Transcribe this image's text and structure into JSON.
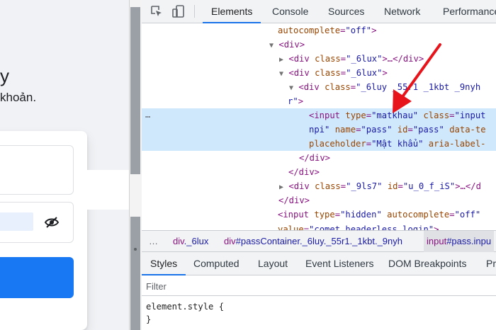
{
  "page": {
    "heading_fragment": "y",
    "subtitle_fragment": "khoản."
  },
  "devtools": {
    "tabs": [
      "Elements",
      "Console",
      "Sources",
      "Network",
      "Performance"
    ],
    "active_tab": "Elements",
    "elements_tree": {
      "l0": {
        "an": "autocomplete",
        "av": "\"off\"",
        "close": ">"
      },
      "l1": {
        "tag": "<div>"
      },
      "l2": {
        "open": "<div ",
        "an": "class",
        "av": "\"_6lux\"",
        "close": ">…</div>"
      },
      "l3": {
        "open": "<div ",
        "an": "class",
        "av": "\"_6lux\"",
        "close": ">"
      },
      "l4": {
        "open": "<div ",
        "an": "class",
        "av": "\"_6luy _55r1 _1kbt _9nyh"
      },
      "l5": {
        "av": "r\"",
        "close": ">"
      },
      "l6": {
        "open": "<input ",
        "an1": "type",
        "av1": "\"matkhau\"",
        "an2": "class",
        "av2": "\"input"
      },
      "l7": {
        "av0": "npi\"",
        "an1": "name",
        "av1": "\"pass\"",
        "an2": "id",
        "av2": "\"pass\"",
        "an3": "data-te"
      },
      "l8": {
        "an1": "placeholder",
        "av1": "\"Mật khẩu\"",
        "an2": "aria-label-"
      },
      "l9": {
        "tag": "</div>"
      },
      "l10": {
        "tag": "</div>"
      },
      "l11": {
        "open": "<div ",
        "an1": "class",
        "av1": "\"_9ls7\"",
        "an2": "id",
        "av2": "\"u_0_f_iS\"",
        "close": ">…</d"
      },
      "l12": {
        "tag": "</div>"
      },
      "l13": {
        "open": "<input ",
        "an1": "type",
        "av1": "\"hidden\"",
        "an2": "autocomplete",
        "av2": "\"off\""
      },
      "l14": {
        "an": "value",
        "av": "\"comet_headerless_login\"",
        "close": ">"
      }
    },
    "selected_marker": "…",
    "breadcrumbs": {
      "more": "…",
      "c1_tag": "div",
      "c1_rest": "._6lux",
      "c2_tag": "div",
      "c2_rest": "#passContainer._6luy._55r1._1kbt._9nyh",
      "c3_tag": "input",
      "c3_rest": "#pass.inpu"
    },
    "subtabs": [
      "Styles",
      "Computed",
      "Layout",
      "Event Listeners",
      "DOM Breakpoints",
      "Pr"
    ],
    "active_subtab": "Styles",
    "filter_placeholder": "Filter",
    "style_rules": {
      "selector_line": "element.style {",
      "close_line": "}"
    }
  },
  "colors": {
    "accent": "#1a73e8",
    "arrow": "#e8141b",
    "selection": "#cfe8fc",
    "login_button": "#1877f2"
  },
  "icons": [
    "inspect-element-icon",
    "device-toolbar-icon",
    "eye-slash-icon",
    "red-arrow-annotation"
  ]
}
